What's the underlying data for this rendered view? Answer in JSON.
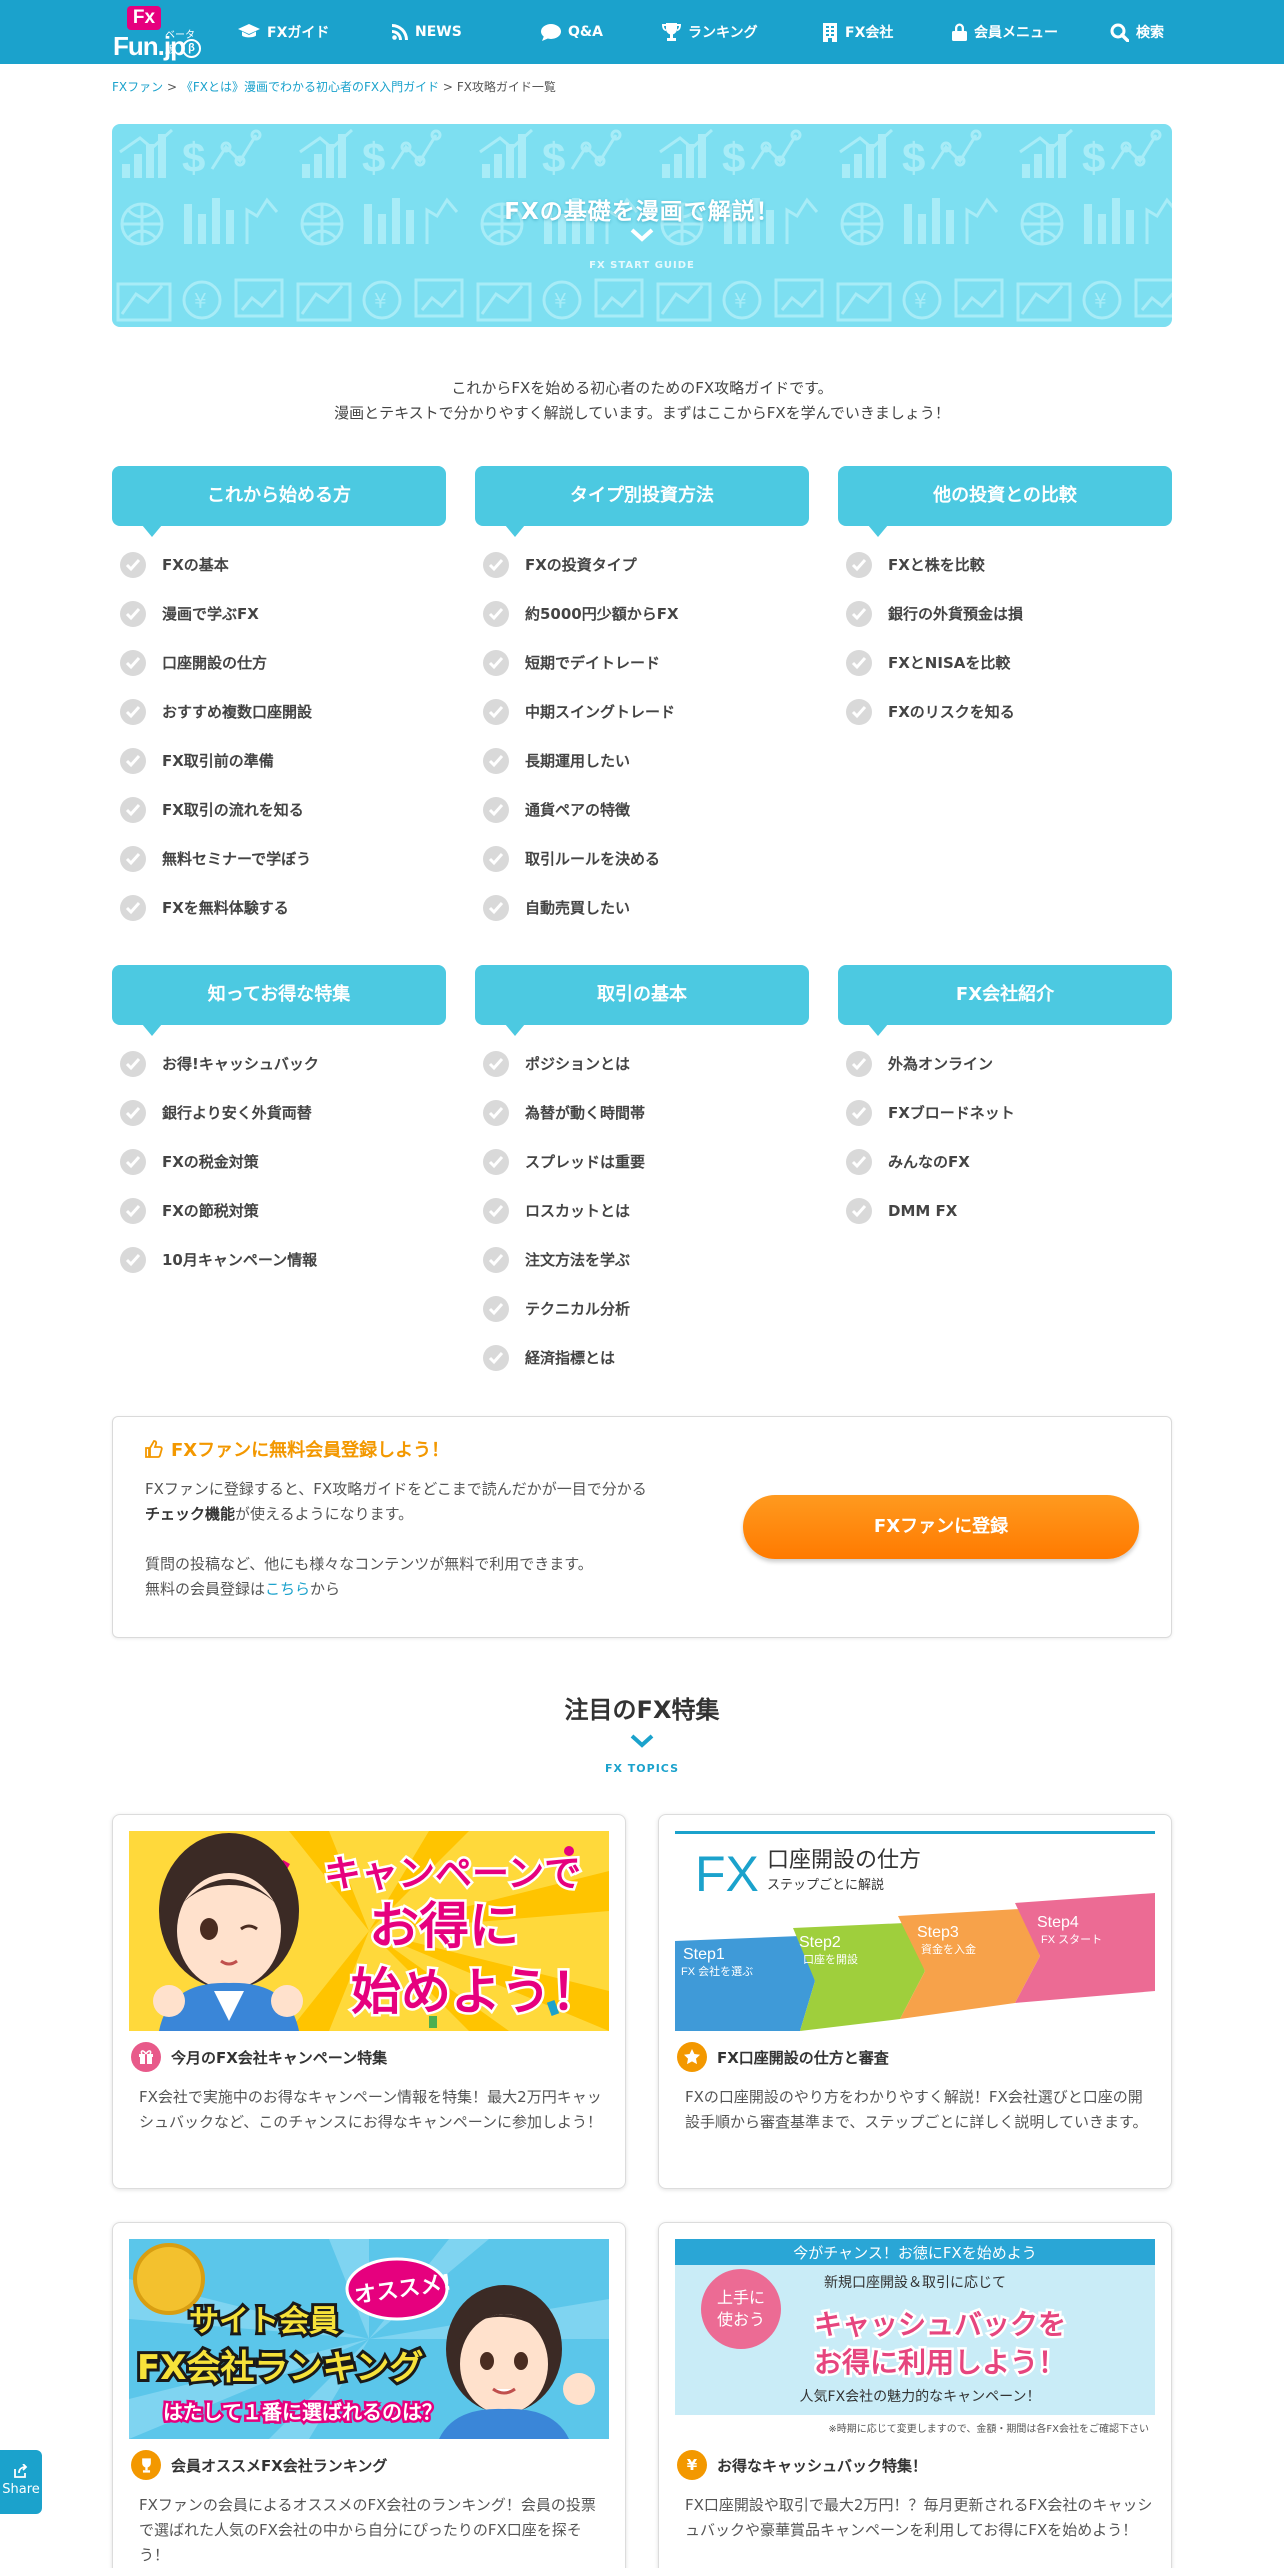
{
  "header": {
    "logo": {
      "fx": "Fx",
      "name": "Fun.jp",
      "beta": "ベータ版",
      "badge": "β"
    },
    "nav": [
      {
        "label": "FXガイド",
        "icon": "graduation-cap-icon"
      },
      {
        "label": "NEWS",
        "icon": "rss-icon"
      },
      {
        "label": "Q&A",
        "icon": "speech-bubble-icon"
      },
      {
        "label": "ランキング",
        "icon": "trophy-icon"
      },
      {
        "label": "FX会社",
        "icon": "building-icon"
      },
      {
        "label": "会員メニュー",
        "icon": "lock-icon"
      },
      {
        "label": "検索",
        "icon": "search-icon"
      }
    ]
  },
  "breadcrumb": {
    "items": [
      "FXファン",
      "《FXとは》漫画でわかる初心者のFX入門ガイド"
    ],
    "current": "FX攻略ガイド一覧",
    "separator": ">"
  },
  "hero": {
    "title": "FXの基礎を漫画で解説！",
    "subtitle": "FX START GUIDE"
  },
  "intro": {
    "line1": "これからFXを始める初心者のためのFX攻略ガイドです。",
    "line2": "漫画とテキストで分かりやすく解説しています。まずはここからFXを学んでいきましょう！"
  },
  "guides": [
    {
      "title": "これから始める方",
      "items": [
        "FXの基本",
        "漫画で学ぶFX",
        "口座開設の仕方",
        "おすすめ複数口座開設",
        "FX取引前の準備",
        "FX取引の流れを知る",
        "無料セミナーで学ぼう",
        "FXを無料体験する"
      ]
    },
    {
      "title": "タイプ別投資方法",
      "items": [
        "FXの投資タイプ",
        "約5000円少額からFX",
        "短期でデイトレード",
        "中期スイングトレード",
        "長期運用したい",
        "通貨ペアの特徴",
        "取引ルールを決める",
        "自動売買したい"
      ]
    },
    {
      "title": "他の投資との比較",
      "items": [
        "FXと株を比較",
        "銀行の外貨預金は損",
        "FXとNISAを比較",
        "FXのリスクを知る"
      ]
    },
    {
      "title": "知ってお得な特集",
      "items": [
        "お得!キャッシュバック",
        "銀行より安く外貨両替",
        "FXの税金対策",
        "FXの節税対策",
        "10月キャンペーン情報"
      ]
    },
    {
      "title": "取引の基本",
      "items": [
        "ポジションとは",
        "為替が動く時間帯",
        "スプレッドは重要",
        "ロスカットとは",
        "注文方法を学ぶ",
        "テクニカル分析",
        "経済指標とは"
      ]
    },
    {
      "title": "FX会社紹介",
      "items": [
        "外為オンライン",
        "FXブロードネット",
        "みんなのFX",
        "DMM FX"
      ]
    }
  ],
  "register": {
    "title": "FXファンに無料会員登録しよう！",
    "text1": "FXファンに登録すると、FX攻略ガイドをどこまで読んだかが一目で分かる",
    "text_bold": "チェック機能",
    "text2": "が使えるようになります。",
    "text3": "質問の投稿など、他にも様々なコンテンツが無料で利用できます。",
    "text4": "無料の会員登録は",
    "link": "こちら",
    "text5": "から",
    "button": "FXファンに登録"
  },
  "topics": {
    "title": "注目のFX特集",
    "subtitle": "FX TOPICS",
    "cards": [
      {
        "title": "今月のFX会社キャンペーン特集",
        "desc": "FX会社で実施中のお得なキャンペーン情報を特集！最大2万円キャッシュバックなど、このチャンスにお得なキャンペーンに参加しよう！",
        "icon": "gift-icon",
        "icon_color": "#e85a8a",
        "banner": {
          "line1": "キャンペーンで",
          "line2": "お得に",
          "line3": "始めよう！"
        }
      },
      {
        "title": "FX口座開設の仕方と審査",
        "desc": "FXの口座開設のやり方をわかりやすく解説！FX会社選びと口座の開設手順から審査基準まで、ステップごとに詳しく説明していきます。",
        "icon": "star-icon",
        "icon_color": "#f39800",
        "banner": {
          "fx": "FX",
          "title": "口座開設の仕方",
          "sub": "ステップごとに解説",
          "steps": [
            {
              "label": "Step1",
              "text": "FX 会社を選ぶ"
            },
            {
              "label": "Step2",
              "text": "口座を開設"
            },
            {
              "label": "Step3",
              "text": "資金を入金"
            },
            {
              "label": "Step4",
              "text": "FX スタート"
            }
          ]
        }
      },
      {
        "title": "会員オススメFX会社ランキング",
        "desc": "FXファンの会員によるオススメのFX会社のランキング！会員の投票で選ばれた人気のFX会社の中から自分にぴったりのFX口座を探そう！",
        "icon": "trophy-icon",
        "icon_color": "#f39800",
        "banner": {
          "line1": "サイト会員",
          "badge": "オススメ!",
          "line2": "FX会社ランキング",
          "line3": "はたして１番に選ばれるのは？"
        }
      },
      {
        "title": "お得なキャッシュバック特集！",
        "desc": "FX口座開設や取引で最大2万円！？毎月更新されるFX会社のキャッシュバックや豪華賞品キャンペーンを利用してお得にFXを始めよう！",
        "icon": "yen-icon",
        "icon_color": "#f39800",
        "banner": {
          "top": "今がチャンス！お徳にFXを始めよう",
          "sub": "新規口座開設＆取引に応じて",
          "bubble1": "上手に",
          "bubble2": "使おう",
          "line1": "キャッシュバックを",
          "line2": "お得に利用しよう！",
          "line3": "人気FX会社の魅力的なキャンペーン！",
          "note": "※時期に応じて変更しますので、金額・期間は各FX会社をご確認下さい"
        }
      }
    ]
  },
  "share": {
    "label": "Share"
  },
  "colors": {
    "brand": "#1ba2cc",
    "accent": "#4cc9e1",
    "orange": "#ff8a00"
  }
}
